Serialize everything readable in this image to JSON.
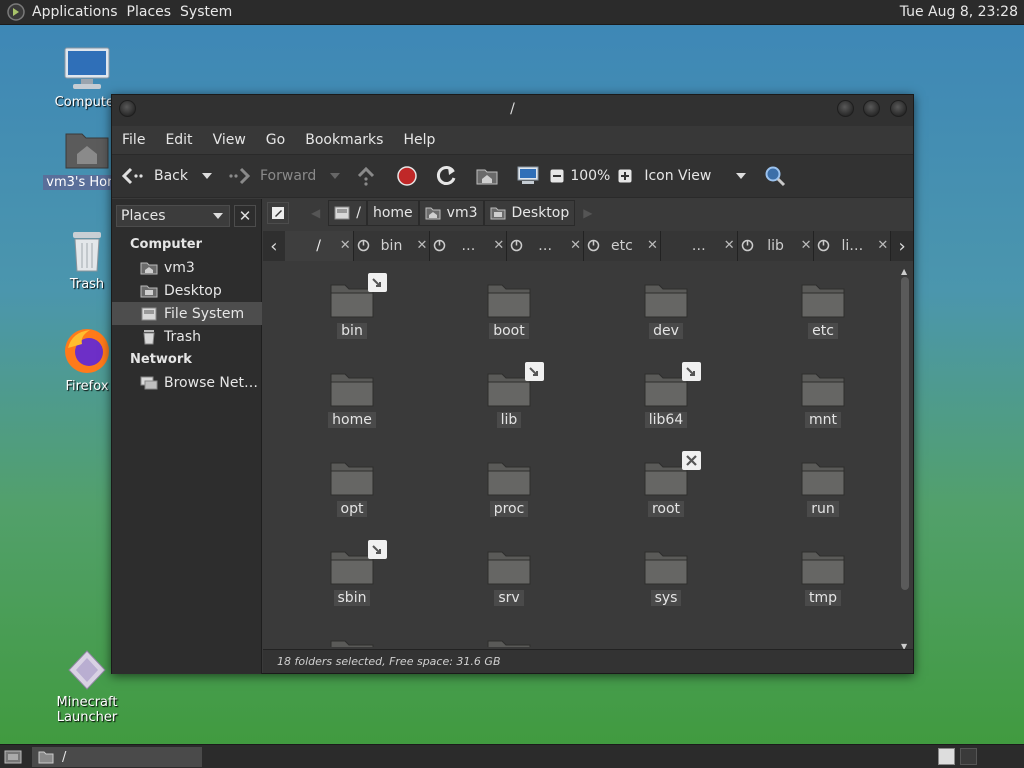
{
  "top_panel": {
    "menus": [
      "Applications",
      "Places",
      "System"
    ],
    "clock": "Tue Aug  8, 23:28"
  },
  "desktop": {
    "icons": [
      {
        "label": "Computer",
        "icon": "computer-icon"
      },
      {
        "label": "vm3's Home",
        "icon": "home-folder-icon"
      },
      {
        "label": "Trash",
        "icon": "trash-icon"
      },
      {
        "label": "Firefox",
        "icon": "firefox-icon"
      },
      {
        "label": "Minecraft Launcher",
        "icon": "minecraft-icon"
      }
    ]
  },
  "window": {
    "title": "/",
    "menu": [
      "File",
      "Edit",
      "View",
      "Go",
      "Bookmarks",
      "Help"
    ],
    "toolbar": {
      "back": "Back",
      "forward": "Forward",
      "zoom": "100%",
      "view_mode": "Icon View"
    },
    "sidebar": {
      "selector": "Places",
      "sections": [
        {
          "title": "Computer",
          "items": [
            {
              "label": "vm3",
              "icon": "home-icon"
            },
            {
              "label": "Desktop",
              "icon": "desktop-icon"
            },
            {
              "label": "File System",
              "icon": "drive-icon",
              "selected": true
            },
            {
              "label": "Trash",
              "icon": "trash-icon"
            }
          ]
        },
        {
          "title": "Network",
          "items": [
            {
              "label": "Browse Net…",
              "icon": "network-icon"
            }
          ]
        }
      ]
    },
    "pathbar": [
      "/",
      "home",
      "vm3",
      "Desktop"
    ],
    "tabs": [
      "/",
      "bin",
      "…",
      "…",
      "etc",
      "…",
      "lib",
      "li…"
    ],
    "folders": [
      {
        "name": "bin",
        "emblem": "link"
      },
      {
        "name": "boot"
      },
      {
        "name": "dev"
      },
      {
        "name": "etc"
      },
      {
        "name": "home"
      },
      {
        "name": "lib",
        "emblem": "link"
      },
      {
        "name": "lib64",
        "emblem": "link"
      },
      {
        "name": "mnt"
      },
      {
        "name": "opt"
      },
      {
        "name": "proc"
      },
      {
        "name": "root",
        "emblem": "unreadable"
      },
      {
        "name": "run"
      },
      {
        "name": "sbin",
        "emblem": "link"
      },
      {
        "name": "srv"
      },
      {
        "name": "sys"
      },
      {
        "name": "tmp"
      }
    ],
    "status": "18 folders selected, Free space: 31.6 GB"
  },
  "taskbar": {
    "task_label": "/"
  }
}
